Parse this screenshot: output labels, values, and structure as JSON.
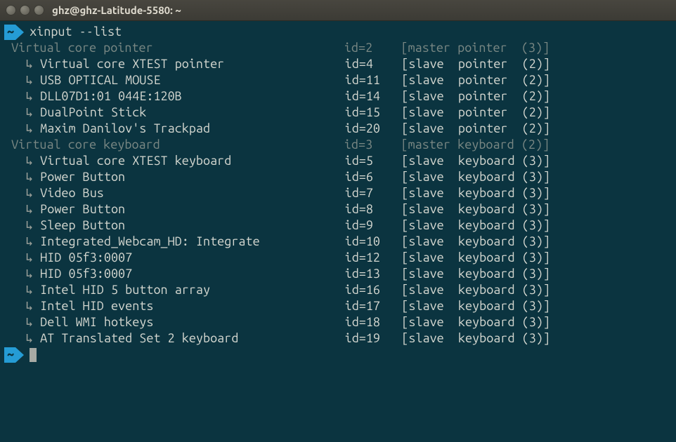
{
  "window": {
    "title": "ghz@ghz-Latitude-5580: ~",
    "buttons": {
      "close": "×",
      "minimize": "–",
      "maximize": "▫"
    }
  },
  "prompt": {
    "path": "~",
    "command": "xinput --list"
  },
  "output": {
    "pointer_header": {
      "name": "Virtual core pointer",
      "id": "id=2",
      "role": "[master pointer  (3)]"
    },
    "pointer_devices": [
      {
        "name": "Virtual core XTEST pointer",
        "id": "id=4",
        "role": "[slave  pointer  (2)]"
      },
      {
        "name": "USB OPTICAL MOUSE",
        "id": "id=11",
        "role": "[slave  pointer  (2)]"
      },
      {
        "name": "DLL07D1:01 044E:120B",
        "id": "id=14",
        "role": "[slave  pointer  (2)]"
      },
      {
        "name": "DualPoint Stick",
        "id": "id=15",
        "role": "[slave  pointer  (2)]"
      },
      {
        "name": "Maxim Danilov's Trackpad",
        "id": "id=20",
        "role": "[slave  pointer  (2)]"
      }
    ],
    "keyboard_header": {
      "name": "Virtual core keyboard",
      "id": "id=3",
      "role": "[master keyboard (2)]"
    },
    "keyboard_devices": [
      {
        "name": "Virtual core XTEST keyboard",
        "id": "id=5",
        "role": "[slave  keyboard (3)]"
      },
      {
        "name": "Power Button",
        "id": "id=6",
        "role": "[slave  keyboard (3)]"
      },
      {
        "name": "Video Bus",
        "id": "id=7",
        "role": "[slave  keyboard (3)]"
      },
      {
        "name": "Power Button",
        "id": "id=8",
        "role": "[slave  keyboard (3)]"
      },
      {
        "name": "Sleep Button",
        "id": "id=9",
        "role": "[slave  keyboard (3)]"
      },
      {
        "name": "Integrated_Webcam_HD: Integrate",
        "id": "id=10",
        "role": "[slave  keyboard (3)]"
      },
      {
        "name": "HID 05f3:0007",
        "id": "id=12",
        "role": "[slave  keyboard (3)]"
      },
      {
        "name": "HID 05f3:0007",
        "id": "id=13",
        "role": "[slave  keyboard (3)]"
      },
      {
        "name": "Intel HID 5 button array",
        "id": "id=16",
        "role": "[slave  keyboard (3)]"
      },
      {
        "name": "Intel HID events",
        "id": "id=17",
        "role": "[slave  keyboard (3)]"
      },
      {
        "name": "Dell WMI hotkeys",
        "id": "id=18",
        "role": "[slave  keyboard (3)]"
      },
      {
        "name": "AT Translated Set 2 keyboard",
        "id": "id=19",
        "role": "[slave  keyboard (3)]"
      }
    ]
  },
  "layout": {
    "name_col_width": 47,
    "id_col_width": 8
  }
}
